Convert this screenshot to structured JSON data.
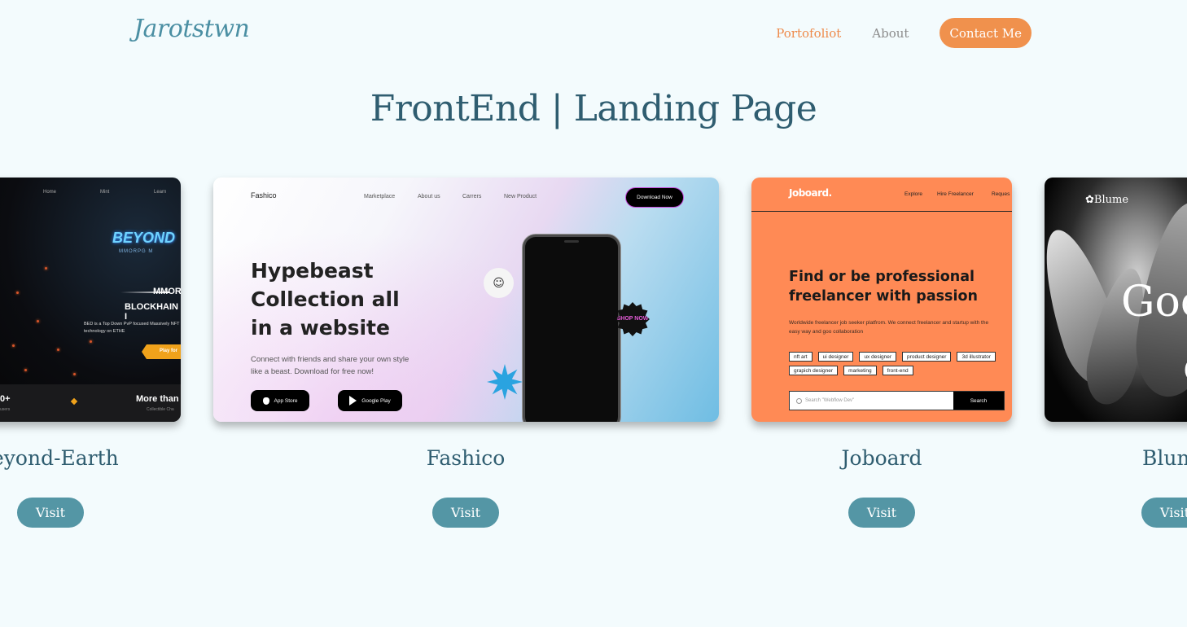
{
  "header": {
    "logo": "Jarotstwn",
    "nav": [
      {
        "label": "Portofoliot",
        "active": true
      },
      {
        "label": "About",
        "active": false
      }
    ],
    "contact_label": "Contact Me"
  },
  "page_title": "FrontEnd | Landing Page",
  "projects": [
    {
      "name": "Beyond-Earth",
      "caption": "eyond-Earth",
      "visit_label": "Visit",
      "preview": {
        "nav": [
          "Home",
          "Mint",
          "Learn"
        ],
        "logo": "BEYOND",
        "sub": "MMORPG M",
        "heading_1": "MMOR",
        "heading_2": "BLOCKHAIN I",
        "desc": "BED is a Top Down PvP focused Massively NFT technology on ETHE",
        "play": "Play for",
        "stat": "0+",
        "stat_label": "users",
        "more": "More than",
        "more_label": "Collectible Cha"
      }
    },
    {
      "name": "Fashico",
      "caption": "Fashico",
      "visit_label": "Visit",
      "preview": {
        "brand": "Fashico",
        "nav": [
          "Marketplace",
          "About us",
          "Carrers",
          "New Product"
        ],
        "download": "Download Now",
        "heading": "Hypebeast Collection all in a website",
        "desc": "Connect with friends and share your own style like a beast. Download for free now!",
        "app_store": "App Store",
        "google_play": "Google Play",
        "shop_now": "SHOP NOW"
      }
    },
    {
      "name": "Joboard",
      "caption": "Joboard",
      "visit_label": "Visit",
      "preview": {
        "brand": "Joboard.",
        "nav": [
          "Explore",
          "Hire Freelancer",
          "Reques"
        ],
        "heading": "Find or be professional freelancer with passion",
        "desc": "Worldwide freelancer job seeker platfrom. We connect freelancer and startup with the easy way and goo collaboration",
        "tags": [
          "nft art",
          "ui designer",
          "ux designer",
          "product designer",
          "3d illustrator",
          "grapich designer",
          "marketing",
          "front-end"
        ],
        "search_placeholder": "Search \"Webflow Dev\"",
        "search_button": "Search"
      }
    },
    {
      "name": "Blume",
      "caption": "Blum",
      "visit_label": "Visit",
      "preview": {
        "brand": "Blume",
        "big_1": "Goo",
        "big_2": "c"
      }
    }
  ],
  "colors": {
    "background": "#f3fbfd",
    "title": "#2f5d70",
    "accent": "#f0914d",
    "visit_button": "#5496a5"
  }
}
